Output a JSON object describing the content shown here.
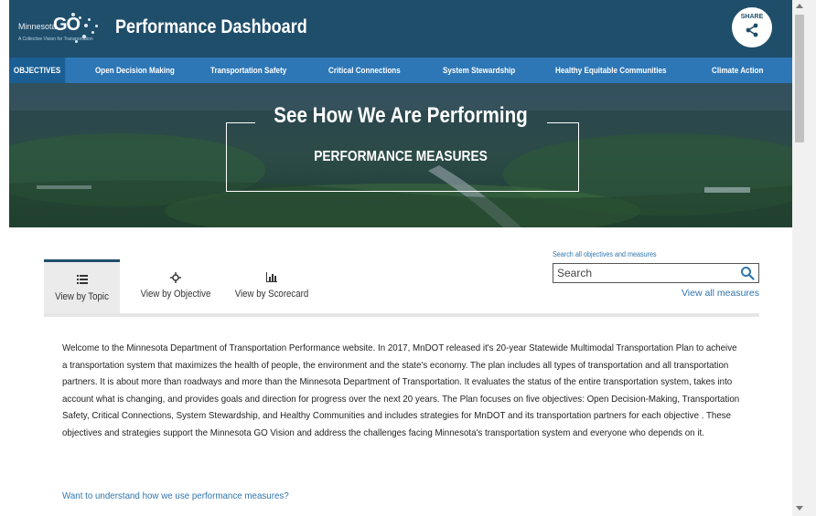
{
  "header": {
    "logo_text": "Minnesota",
    "logo_go": "GO",
    "logo_tagline": "A Collective Vision for Transportation",
    "title": "Performance Dashboard",
    "share_label": "SHARE",
    "share_icon": "share-icon"
  },
  "nav": {
    "items": [
      {
        "label": "OBJECTIVES",
        "active": true
      },
      {
        "label": "Open Decision Making"
      },
      {
        "label": "Transportation Safety"
      },
      {
        "label": "Critical Connections"
      },
      {
        "label": "System Stewardship"
      },
      {
        "label": "Healthy Equitable Communities"
      },
      {
        "label": "Climate Action"
      }
    ]
  },
  "hero": {
    "title": "See How We Are Performing",
    "subtitle": "PERFORMANCE MEASURES"
  },
  "tabs": [
    {
      "label": "View by Topic",
      "icon": "list-icon",
      "active": true
    },
    {
      "label": "View by Objective",
      "icon": "target-icon"
    },
    {
      "label": "View by Scorecard",
      "icon": "bar-chart-icon"
    }
  ],
  "search": {
    "label": "Search all objectives and measures",
    "placeholder": "Search",
    "view_all": "View all measures"
  },
  "intro": {
    "text": "Welcome to the Minnesota Department of Transportation Performance website.  In 2017,  MnDOT released it's 20-year Statewide Multimodal Transportation Plan to acheive a transportation system that maximizes the health of people, the environment and the state's economy. The plan includes all types of transportation and all transportation partners. It is about more than roadways and more than the Minnesota Department of Transportation. It evaluates the status of the entire transportation system, takes into account what is changing, and provides goals and direction for progress over the next 20 years. The  Plan focuses on five objectives: Open Decision-Making, Transportation Safety, Critical Connections, System Stewardship, and Healthy Communities and includes strategies for MnDOT and its transportation partners for each objective . These objectives and strategies support the Minnesota GO Vision and address the challenges facing Minnesota's transportation system and everyone who depends on it.",
    "link": "Want to understand how we use performance measures?"
  },
  "colors": {
    "header_bg": "#1f4e6b",
    "nav_bg": "#2e77b6",
    "link": "#2f76ae"
  }
}
